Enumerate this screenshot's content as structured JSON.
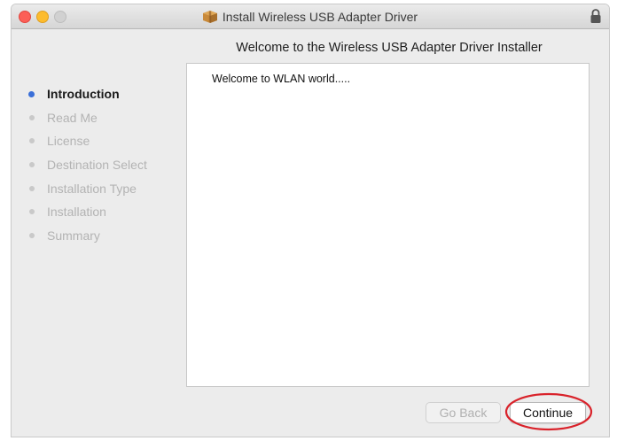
{
  "window": {
    "title": "Install Wireless USB Adapter Driver"
  },
  "heading": "Welcome to the Wireless USB Adapter Driver Installer",
  "sidebar": {
    "steps": [
      {
        "label": "Introduction",
        "active": true
      },
      {
        "label": "Read Me",
        "active": false
      },
      {
        "label": "License",
        "active": false
      },
      {
        "label": "Destination Select",
        "active": false
      },
      {
        "label": "Installation Type",
        "active": false
      },
      {
        "label": "Installation",
        "active": false
      },
      {
        "label": "Summary",
        "active": false
      }
    ]
  },
  "content": {
    "text": "Welcome to WLAN world....."
  },
  "buttons": {
    "back_label": "Go Back",
    "continue_label": "Continue"
  },
  "colors": {
    "active_dot": "#3a6fd8",
    "highlight_ring": "#d9232b"
  },
  "icons": {
    "title": "package-icon",
    "lock": "lock-icon"
  }
}
